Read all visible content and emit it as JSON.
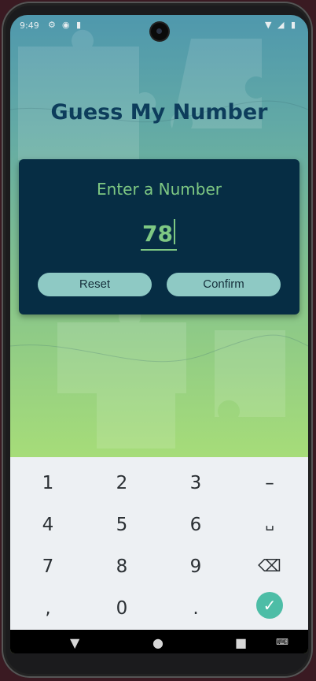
{
  "status": {
    "time": "9:49"
  },
  "app": {
    "title": "Guess My Number",
    "prompt": "Enter a Number",
    "input_value": "78",
    "reset_label": "Reset",
    "confirm_label": "Confirm"
  },
  "keyboard": {
    "row1": [
      "1",
      "2",
      "3",
      "–"
    ],
    "row2": [
      "4",
      "5",
      "6",
      "␣"
    ],
    "row3": [
      "7",
      "8",
      "9"
    ],
    "row4": [
      ",",
      "0",
      "."
    ],
    "done": "✓",
    "backspace": "⌫"
  },
  "colors": {
    "accent": "#7ec883",
    "card": "#062d44",
    "button": "#8ec9c4",
    "title": "#0d3d5c"
  }
}
